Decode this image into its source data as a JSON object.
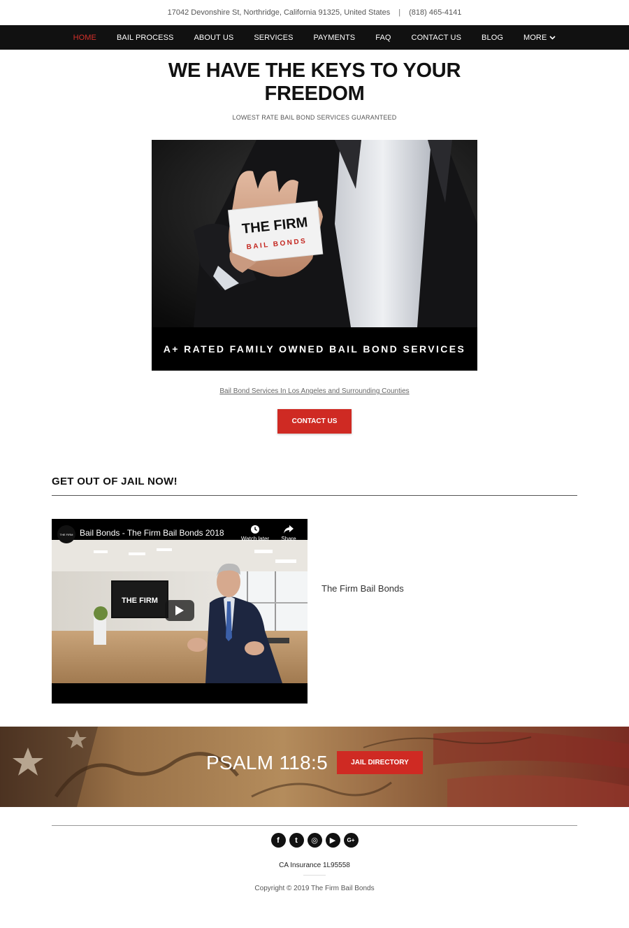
{
  "topbar": {
    "address": "17042 Devonshire St, Northridge, California 91325, United States",
    "separator": "|",
    "phone": "(818) 465-4141"
  },
  "nav": {
    "items": [
      {
        "label": "HOME",
        "active": true
      },
      {
        "label": "BAIL PROCESS"
      },
      {
        "label": "ABOUT US"
      },
      {
        "label": "SERVICES"
      },
      {
        "label": "PAYMENTS"
      },
      {
        "label": "FAQ"
      },
      {
        "label": "CONTACT US"
      },
      {
        "label": "BLOG"
      },
      {
        "label": "MORE"
      }
    ],
    "more_icon": "chevron-down-icon",
    "active_color": "#d4302a"
  },
  "hero": {
    "title_line1": "WE HAVE THE KEYS TO YOUR",
    "title_line2": "FREEDOM",
    "subtitle": "LOWEST RATE BAIL BOND SERVICES GUARANTEED",
    "card_line1": "THE FIRM",
    "card_line2": "BAIL BONDS",
    "banner": "A+ RATED FAMILY OWNED BAIL BOND SERVICES",
    "link": "Bail Bond Services In Los Angeles and Surrounding Counties",
    "contact_button": "CONTACT US"
  },
  "section": {
    "title": "GET OUT OF JAIL NOW!"
  },
  "video": {
    "title": "Bail Bonds - The Firm Bail Bonds 2018",
    "channel_logo": "THE FIRM",
    "watch_later": "Watch later",
    "share": "Share",
    "screen_text": "THE FIRM",
    "caption": "The Firm Bail Bonds"
  },
  "psalm": {
    "text": "PSALM 118:5",
    "button": "JAIL DIRECTORY"
  },
  "footer": {
    "social": [
      {
        "icon": "facebook-icon",
        "glyph": "f"
      },
      {
        "icon": "twitter-icon",
        "glyph": "t"
      },
      {
        "icon": "instagram-icon",
        "glyph": "◎"
      },
      {
        "icon": "youtube-icon",
        "glyph": "▶"
      },
      {
        "icon": "google-plus-icon",
        "glyph": "G+"
      }
    ],
    "insurance": "CA Insurance 1L95558",
    "copyright": "Copyright © 2019 The Firm Bail Bonds"
  },
  "colors": {
    "accent_red": "#cf2a23",
    "nav_bg": "#111111"
  }
}
